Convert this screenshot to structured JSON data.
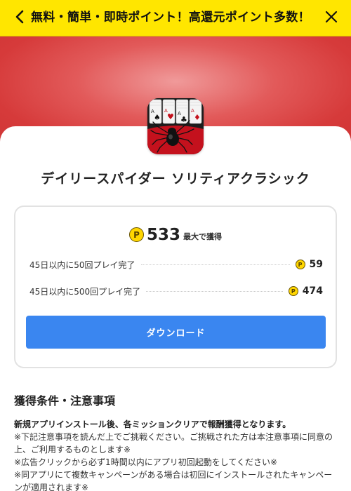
{
  "header": {
    "title": "無料・簡単・即時ポイント！高還元ポイント多数！"
  },
  "app": {
    "name": "デイリースパイダー ソリティアクラシック",
    "icon": "spider-solitaire-app-icon"
  },
  "reward": {
    "coin_symbol": "P",
    "max_points": "533",
    "max_label": "最大で獲得",
    "missions": [
      {
        "label": "45日以内に50回プレイ完了",
        "points": "59"
      },
      {
        "label": "45日以内に500回プレイ完了",
        "points": "474"
      }
    ],
    "download_label": "ダウンロード"
  },
  "conditions": {
    "heading": "獲得条件・注意事項",
    "lead": "新規アプリインストール後、各ミッションクリアで報酬獲得となります。",
    "notes": [
      "※下記注意事項を読んだ上でご挑戦ください。ご挑戦された方は本注意事項に同意の上、ご利用するものとします※",
      "※広告クリックから必ず1時間以内にアプリ初回起動をしてください※",
      "※同アプリにて複数キャンペーンがある場合は初回にインストールされたキャンペーンが適用されます※"
    ]
  },
  "colors": {
    "header_bg": "#ffe600",
    "hero_bg": "#d63a3a",
    "button_bg": "#3a86f0",
    "coin": "#ffd600"
  }
}
